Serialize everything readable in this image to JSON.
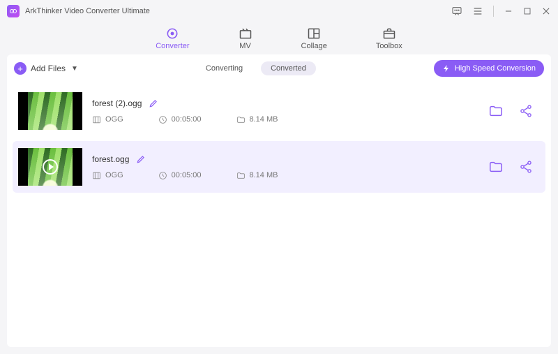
{
  "app": {
    "title": "ArkThinker Video Converter Ultimate"
  },
  "tabs": {
    "converter": "Converter",
    "mv": "MV",
    "collage": "Collage",
    "toolbox": "Toolbox"
  },
  "toolbar": {
    "add_files": "Add Files",
    "converting": "Converting",
    "converted": "Converted",
    "hs_label": "High Speed Conversion"
  },
  "items": [
    {
      "name": "forest (2).ogg",
      "format": "OGG",
      "duration": "00:05:00",
      "size": "8.14 MB",
      "playable": false,
      "highlight": false
    },
    {
      "name": "forest.ogg",
      "format": "OGG",
      "duration": "00:05:00",
      "size": "8.14 MB",
      "playable": true,
      "highlight": true
    }
  ],
  "colors": {
    "accent": "#8a5cf5"
  }
}
